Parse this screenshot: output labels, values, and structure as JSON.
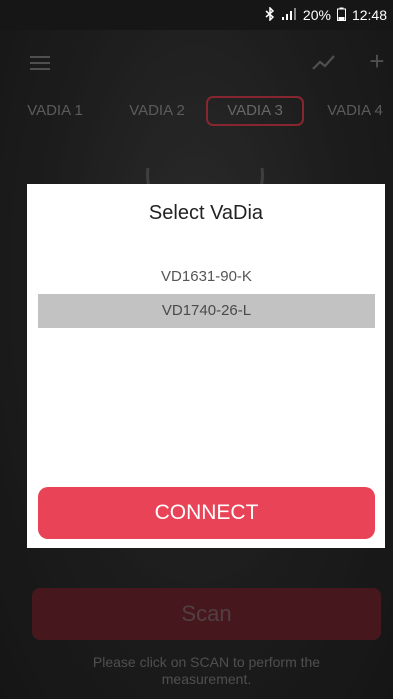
{
  "status_bar": {
    "bluetooth_icon": "bluetooth-icon",
    "signal_icon": "signal-icon",
    "battery_text": "20%",
    "battery_icon": "battery-icon",
    "time": "12:48"
  },
  "toolbar": {
    "menu_icon": "hamburger-menu-icon",
    "trend_icon": "trend-chart-icon",
    "add_icon": "plus-icon"
  },
  "tabs": [
    {
      "label": "VADIA 1",
      "active": false
    },
    {
      "label": "VADIA 2",
      "active": false
    },
    {
      "label": "VADIA 3",
      "active": true
    },
    {
      "label": "VADIA 4",
      "active": false
    }
  ],
  "dialog": {
    "title": "Select VaDia",
    "devices": [
      {
        "label": "VD1631-90-K",
        "selected": false
      },
      {
        "label": "VD1740-26-L",
        "selected": true
      }
    ],
    "connect_label": "CONNECT"
  },
  "main": {
    "scan_label": "Scan",
    "hint_text": "Please click on SCAN to perform the measurement."
  },
  "colors": {
    "accent": "#e84356",
    "active_tab_border": "#b3343f",
    "selected_row": "#c2c2c2"
  }
}
